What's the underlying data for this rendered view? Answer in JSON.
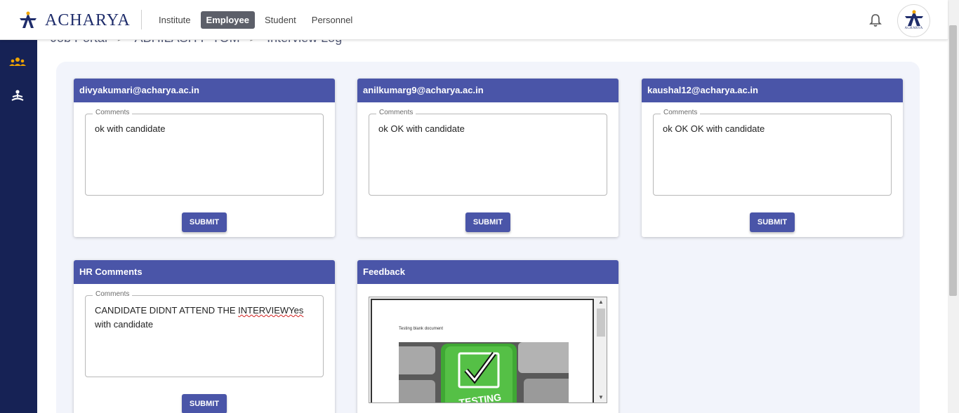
{
  "header": {
    "logo_text": "ACHARYA",
    "nav": [
      {
        "label": "Institute"
      },
      {
        "label": "Employee"
      },
      {
        "label": "Student"
      },
      {
        "label": "Personnel"
      }
    ],
    "active_nav": "Employee",
    "avatar_text": "ACHARYA"
  },
  "breadcrumb": {
    "items": [
      "Job Portal",
      "ABHILASH P TOM",
      "Interview Log"
    ],
    "separator": ">"
  },
  "cards": [
    {
      "title": "divyakumari@acharya.ac.in",
      "field_label": "Comments",
      "comment": "ok with candidate",
      "submit_label": "SUBMIT"
    },
    {
      "title": "anilkumarg9@acharya.ac.in",
      "field_label": "Comments",
      "comment": "ok OK with candidate",
      "submit_label": "SUBMIT"
    },
    {
      "title": "kaushal12@acharya.ac.in",
      "field_label": "Comments",
      "comment": "ok OK OK with candidate",
      "submit_label": "SUBMIT"
    }
  ],
  "hr_card": {
    "title": "HR Comments",
    "field_label": "Comments",
    "comment_prefix": "CANDIDATE DIDNT ATTEND THE ",
    "comment_misspelled": "INTERVIEWYes",
    "comment_suffix": " with candidate",
    "submit_label": "SUBMIT"
  },
  "feedback": {
    "title": "Feedback",
    "document_text": "Testing blank document",
    "image_caption": "TESTING"
  },
  "colors": {
    "accent": "#4a55a8",
    "sidebar": "#162255",
    "panel_bg": "#f2f4fb",
    "brand": "#1f2d6b",
    "sidebar_active_icon": "#f0a500"
  },
  "icons": {
    "bell": "bell-icon",
    "sidebar_1": "group-icon",
    "sidebar_2": "meditation-icon"
  }
}
